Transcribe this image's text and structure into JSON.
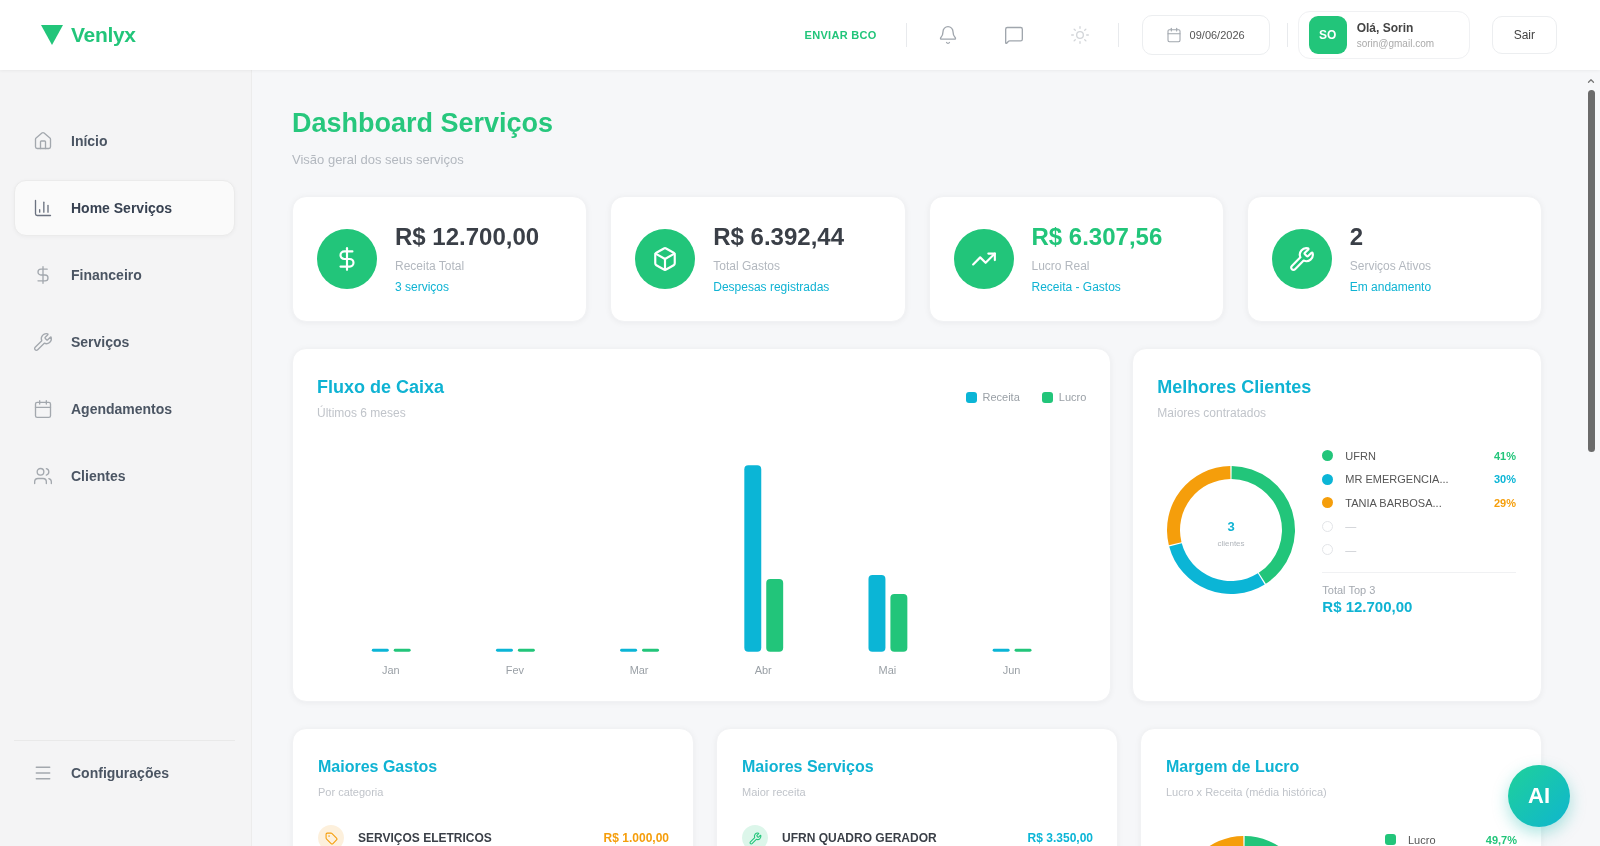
{
  "header": {
    "logo": "Venlyx",
    "action": "ENVIAR BCO",
    "date": "09/06/2026",
    "user": {
      "initials": "SO",
      "name": "Olá, Sorin",
      "email": "sorin@gmail.com"
    },
    "logout": "Sair"
  },
  "sidebar": {
    "items": [
      {
        "label": "Início",
        "selected": false
      },
      {
        "label": "Home Serviços",
        "selected": true
      },
      {
        "label": "Financeiro",
        "selected": false
      },
      {
        "label": "Serviços",
        "selected": false
      },
      {
        "label": "Agendamentos",
        "selected": false
      },
      {
        "label": "Clientes",
        "selected": false
      }
    ],
    "footer_item": {
      "label": "Configurações",
      "selected": false
    }
  },
  "page": {
    "title": "Dashboard Serviços",
    "subtitle": "Visão geral dos seus serviços"
  },
  "stats": [
    {
      "value": "R$ 12.700,00",
      "label": "Receita Total",
      "note": "3 serviços",
      "accent": false
    },
    {
      "value": "R$ 6.392,44",
      "label": "Total Gastos",
      "note": "Despesas registradas",
      "accent": false
    },
    {
      "value": "R$ 6.307,56",
      "label": "Lucro Real",
      "note": "Receita - Gastos",
      "accent": true
    },
    {
      "value": "2",
      "label": "Serviços Ativos",
      "note": "Em andamento",
      "accent": false
    }
  ],
  "cash_flow": {
    "title": "Fluxo de Caixa",
    "subtitle": "Últimos 6 meses",
    "legend": [
      {
        "label": "Receita",
        "color": "#0bb5d6"
      },
      {
        "label": "Lucro",
        "color": "#22c57a"
      }
    ],
    "months": [
      "Jan",
      "Fev",
      "Mar",
      "Abr",
      "Mai",
      "Jun"
    ]
  },
  "top_clients": {
    "title": "Melhores Clientes",
    "subtitle": "Maiores contratados",
    "center_value": "3",
    "center_label": "clientes",
    "items": [
      {
        "name": "UFRN",
        "percent": "41%",
        "color": "#22c57a"
      },
      {
        "name": "MR EMERGENCIA...",
        "percent": "30%",
        "color": "#0bb5d6"
      },
      {
        "name": "TANIA BARBOSA...",
        "percent": "29%",
        "color": "#f59e0b"
      },
      {
        "name": "—"
      },
      {
        "name": "—"
      }
    ],
    "total_label": "Total Top 3",
    "total_value": "R$ 12.700,00"
  },
  "panels": [
    {
      "kind": "expenses",
      "title": "Maiores Gastos",
      "subtitle": "Por categoria",
      "rows": [
        {
          "name": "SERVIÇOS ELETRICOS",
          "amount": "R$ 1.000,00",
          "color": "#f59e0b"
        }
      ]
    },
    {
      "kind": "services",
      "title": "Maiores Serviços",
      "subtitle": "Maior receita",
      "rows": [
        {
          "name": "UFRN QUADRO GERADOR",
          "amount": "R$ 3.350,00",
          "color": "#0bb5d6"
        }
      ]
    },
    {
      "kind": "gauge",
      "title": "Margem de Lucro",
      "subtitle": "Lucro x Receita (média histórica)",
      "legend": [
        {
          "label": "Lucro",
          "value": "49,7%",
          "color": "#22c57a"
        }
      ]
    }
  ],
  "assistant_button": "AI"
}
